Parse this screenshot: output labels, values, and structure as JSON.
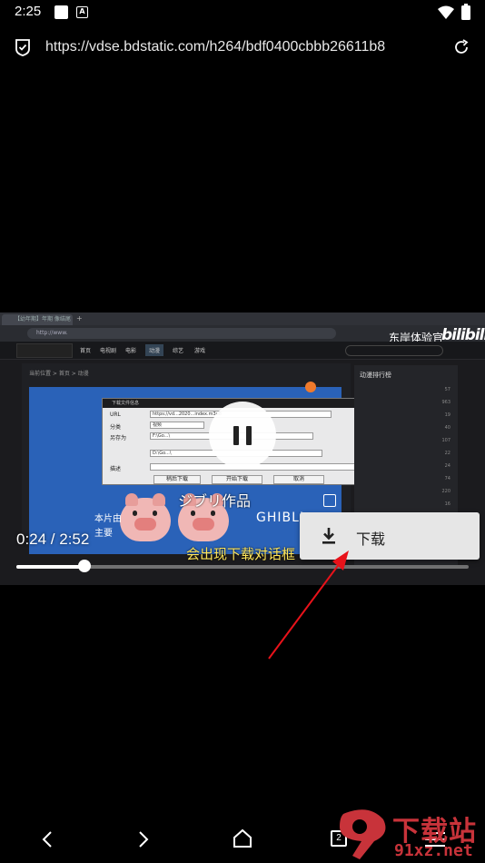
{
  "status_bar": {
    "time": "2:25",
    "notification_glyph": "A"
  },
  "browser": {
    "url": "https://vdse.bdstatic.com/h264/bdf0400cbbb26611b8"
  },
  "video": {
    "tab_title": "【幼年期】年期 像结尾",
    "brand_cn": "东岸体验官",
    "brand_logo": "bilibili",
    "jp_title": "ジブリ作品",
    "ghibli": "GHIBLI",
    "sub_left1": "本片由",
    "sub_left2": "主要",
    "caption": "会出现下载对话框",
    "side_title": "动漫排行榜"
  },
  "player": {
    "time": "0:24 / 2:52",
    "progress": 0.15
  },
  "context_menu": {
    "download_label": "下载"
  },
  "navbar": {
    "tab_count": "2"
  },
  "watermark": {
    "top": "下载站",
    "bottom": "91xz.net"
  },
  "colors": {
    "watermark": "#c8333a",
    "annotation_arrow": "#e8121a",
    "caption": "#ffe65a"
  }
}
